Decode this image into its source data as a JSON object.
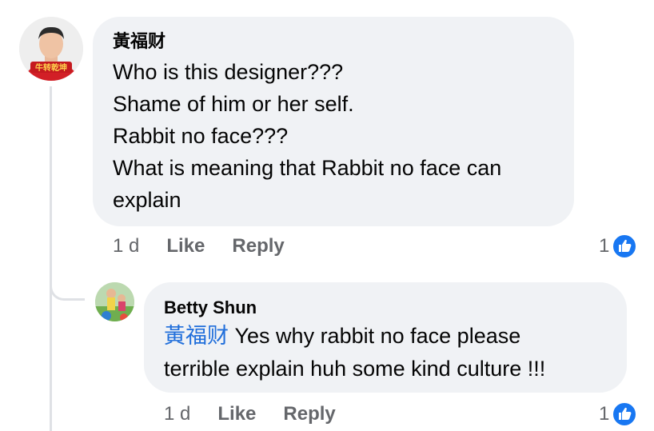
{
  "comments": [
    {
      "author": "黃福财",
      "lines": "Who is this designer???\nShame of him or her self.\nRabbit no face???\nWhat is meaning that Rabbit no face can\nexplain",
      "time": "1 d",
      "like_label": "Like",
      "reply_label": "Reply",
      "reaction_count": "1",
      "reaction_icon": "thumbs-up-icon"
    }
  ],
  "replies": [
    {
      "author": "Betty Shun",
      "mention": "黃福财",
      "text": " Yes why rabbit no face  please\nterrible explain huh  some kind culture !!!",
      "time": "1 d",
      "like_label": "Like",
      "reply_label": "Reply",
      "reaction_count": "1",
      "reaction_icon": "thumbs-up-icon"
    }
  ],
  "colors": {
    "bubble_bg": "#f0f2f5",
    "mention": "#216fdb",
    "meta_text": "#65676b",
    "like_blue": "#1877f2",
    "thread_line": "#dfe1e5"
  }
}
